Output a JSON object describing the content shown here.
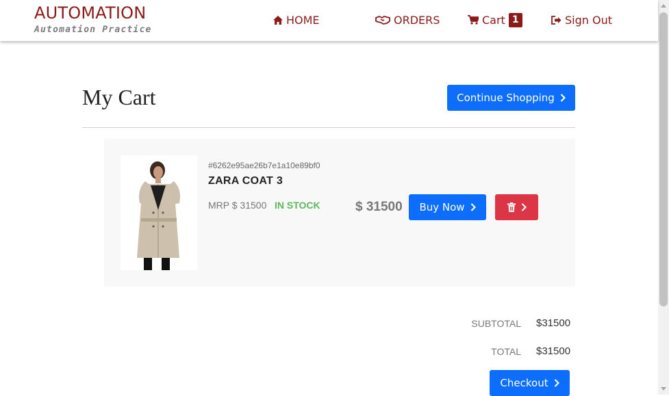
{
  "header": {
    "brand_title": "AUTOMATION",
    "brand_subtitle": "Automation Practice",
    "nav": {
      "home": "HOME",
      "orders": "ORDERS",
      "cart": "Cart",
      "cart_count": "1",
      "sign_out": "Sign Out"
    }
  },
  "main": {
    "title": "My Cart",
    "continue_shopping": "Continue Shopping"
  },
  "cart_items": [
    {
      "id": "#6262e95ae26b7e1a10e89bf0",
      "name": "ZARA COAT 3",
      "mrp": "MRP $ 31500",
      "stock": "IN STOCK",
      "price": "$ 31500",
      "buy_now": "Buy Now"
    }
  ],
  "summary": {
    "subtotal_label": "SUBTOTAL",
    "subtotal_value": "$31500",
    "total_label": "TOTAL",
    "total_value": "$31500",
    "checkout": "Checkout"
  },
  "colors": {
    "brand": "#8b1a1a",
    "primary": "#0d6efd",
    "danger": "#dc3545",
    "stock": "#5cb85c"
  },
  "icons": {
    "home": "home-icon",
    "orders": "handshake-icon",
    "cart": "cart-icon",
    "sign_out": "sign-out-icon",
    "chevron": "chevron-right-icon",
    "delete": "trash-icon"
  }
}
